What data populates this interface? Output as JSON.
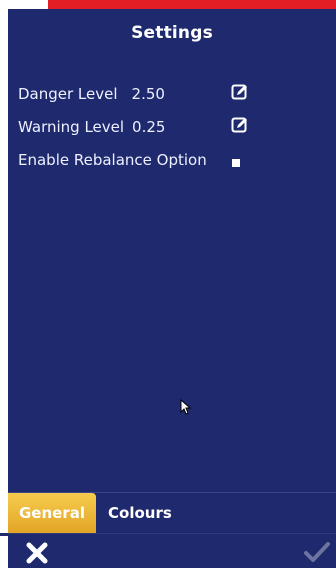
{
  "header": {
    "title": "Settings"
  },
  "settings": {
    "danger": {
      "label": "Danger Level",
      "value": "2.50",
      "edit_icon": "edit-icon"
    },
    "warning": {
      "label": "Warning Level",
      "value": "0.25",
      "edit_icon": "edit-icon"
    },
    "rebalance": {
      "label": "Enable Rebalance Option",
      "checked": false
    }
  },
  "tabs": [
    {
      "label": "General",
      "active": true
    },
    {
      "label": "Colours",
      "active": false
    }
  ],
  "footer": {
    "close_icon": "close-icon",
    "confirm_icon": "checkmark-icon"
  },
  "colors": {
    "panel": "#1f2a6e",
    "active_tab": "#f0bf3f",
    "accent_strip": "#e31e24"
  }
}
